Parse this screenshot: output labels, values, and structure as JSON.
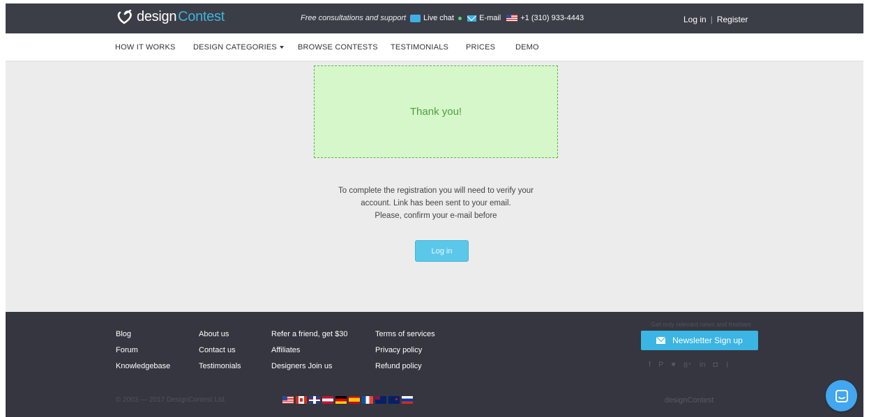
{
  "header": {
    "logo": {
      "part1": "design",
      "part2": "Contest",
      "icon": "heart-pen-logo-icon"
    },
    "contact": {
      "tagline": "Free consultations and support",
      "live_chat": "Live chat",
      "email": "E-mail",
      "phone": "+1 (310) 933-4443"
    },
    "auth": {
      "login": "Log in",
      "separator": "|",
      "register": "Register"
    }
  },
  "nav": {
    "items": [
      {
        "label": "HOW IT WORKS"
      },
      {
        "label": "DESIGN CATEGORIES",
        "has_dropdown": true
      },
      {
        "label": "BROWSE CONTESTS"
      },
      {
        "label": "TESTIMONIALS"
      },
      {
        "label": "PRICES"
      },
      {
        "label": "DEMO"
      }
    ]
  },
  "main": {
    "thanks": "Thank you!",
    "message": [
      "To complete the registration you will need to verify your",
      "account. Link has been sent to your email.",
      "Please, confirm your e-mail before"
    ],
    "login_button": "Log in"
  },
  "footer": {
    "col1": [
      "Blog",
      "Forum",
      "Knowledgebase"
    ],
    "col2": [
      "About us",
      "Contact us",
      "Testimonials"
    ],
    "col3": [
      "Refer a friend, get $30",
      "Affiliates",
      "Designers Join us"
    ],
    "col4": [
      "Terms of services",
      "Privacy policy",
      "Refund policy"
    ],
    "copyright": "© 2003 — 2017 DesignContest Ltd.",
    "newsletter_tagline": "Get only relevant news and freebies",
    "newsletter_button": "Newsletter Sign up",
    "socials": [
      "f",
      "P",
      "♥",
      "8⁺",
      "in",
      "◘",
      "⌇"
    ],
    "logo": "designContest",
    "language_flags": [
      "us",
      "ca",
      "uk",
      "at",
      "de",
      "es",
      "fr",
      "au",
      "nz",
      "ru"
    ]
  },
  "colors": {
    "topbar": "#3b3d47",
    "accent": "#3cb4e0",
    "success_bg": "#d6f7ca",
    "success_text": "#4e9f3d",
    "footer": "#35363f"
  }
}
